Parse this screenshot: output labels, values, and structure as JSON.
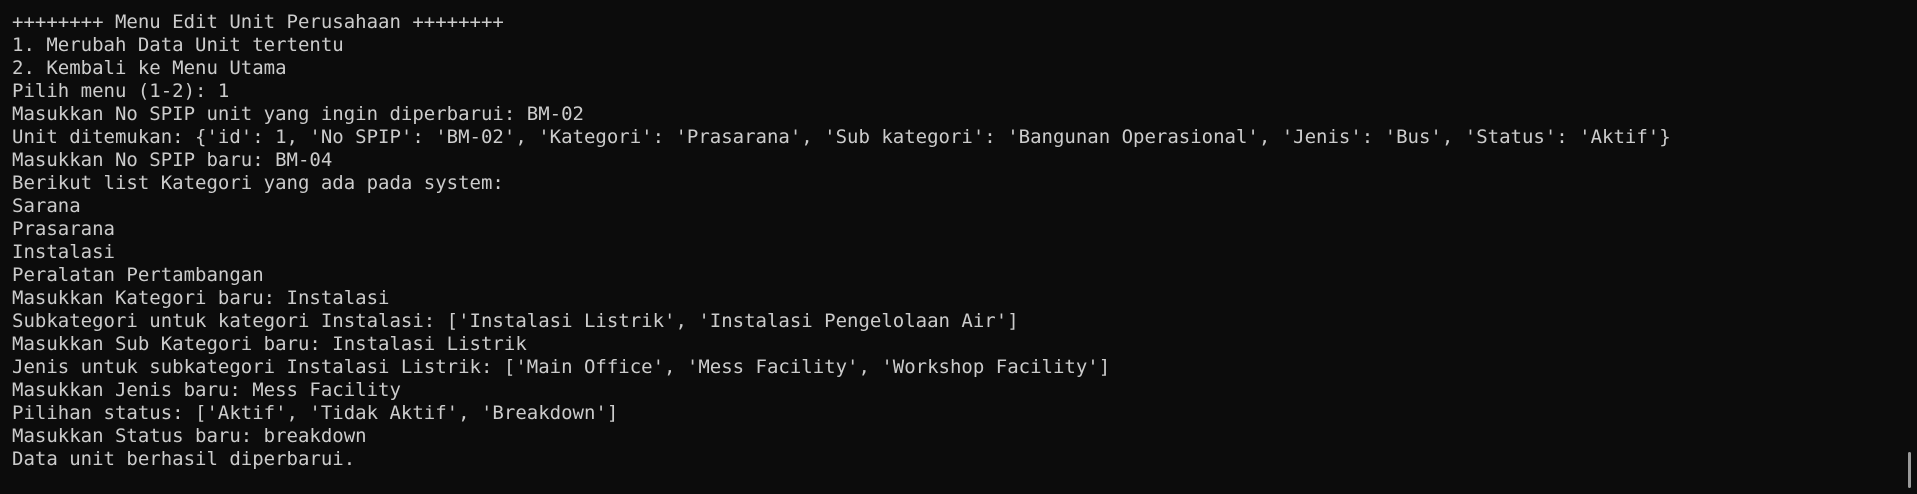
{
  "terminal": {
    "lines": [
      "++++++++ Menu Edit Unit Perusahaan ++++++++",
      "1. Merubah Data Unit tertentu",
      "2. Kembali ke Menu Utama",
      "Pilih menu (1-2): 1",
      "Masukkan No SPIP unit yang ingin diperbarui: BM-02",
      "Unit ditemukan: {'id': 1, 'No SPIP': 'BM-02', 'Kategori': 'Prasarana', 'Sub kategori': 'Bangunan Operasional', 'Jenis': 'Bus', 'Status': 'Aktif'}",
      "Masukkan No SPIP baru: BM-04",
      "Berikut list Kategori yang ada pada system:",
      "Sarana",
      "Prasarana",
      "Instalasi",
      "Peralatan Pertambangan",
      "Masukkan Kategori baru: Instalasi",
      "Subkategori untuk kategori Instalasi: ['Instalasi Listrik', 'Instalasi Pengelolaan Air']",
      "Masukkan Sub Kategori baru: Instalasi Listrik",
      "Jenis untuk subkategori Instalasi Listrik: ['Main Office', 'Mess Facility', 'Workshop Facility']",
      "Masukkan Jenis baru: Mess Facility",
      "Pilihan status: ['Aktif', 'Tidak Aktif', 'Breakdown']",
      "Masukkan Status baru: breakdown",
      "Data unit berhasil diperbarui."
    ]
  },
  "colors": {
    "background": "#0c0c0c",
    "text": "#cccccc"
  }
}
